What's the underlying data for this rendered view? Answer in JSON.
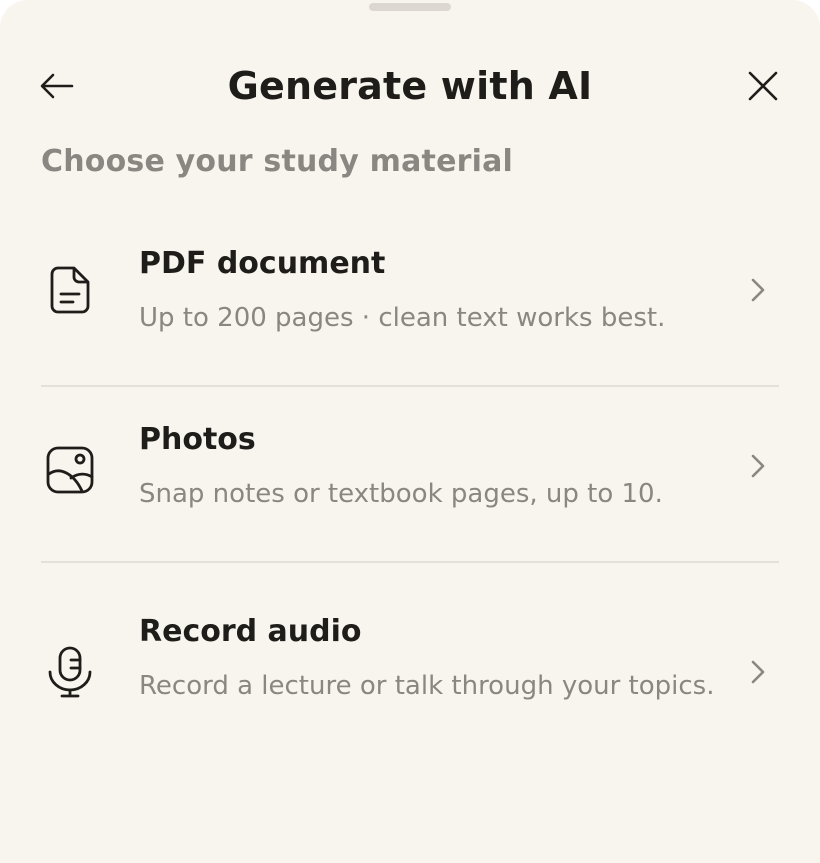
{
  "header": {
    "title": "Generate with AI",
    "back_icon": "arrow-left-icon",
    "close_icon": "close-icon"
  },
  "section_label": "Choose your study material",
  "options": [
    {
      "icon": "document-icon",
      "label": "PDF document",
      "description": "Up to 200 pages · clean text works best."
    },
    {
      "icon": "photo-icon",
      "label": "Photos",
      "description": "Snap notes or textbook pages, up to 10."
    },
    {
      "icon": "microphone-icon",
      "label": "Record audio",
      "description": "Record a lecture or talk through your topics."
    }
  ],
  "colors": {
    "background": "#f8f4ee",
    "text_primary": "#1f1d1a",
    "text_secondary": "#8a8782",
    "divider": "#e4e0da",
    "grabber": "#dcd8d1"
  }
}
